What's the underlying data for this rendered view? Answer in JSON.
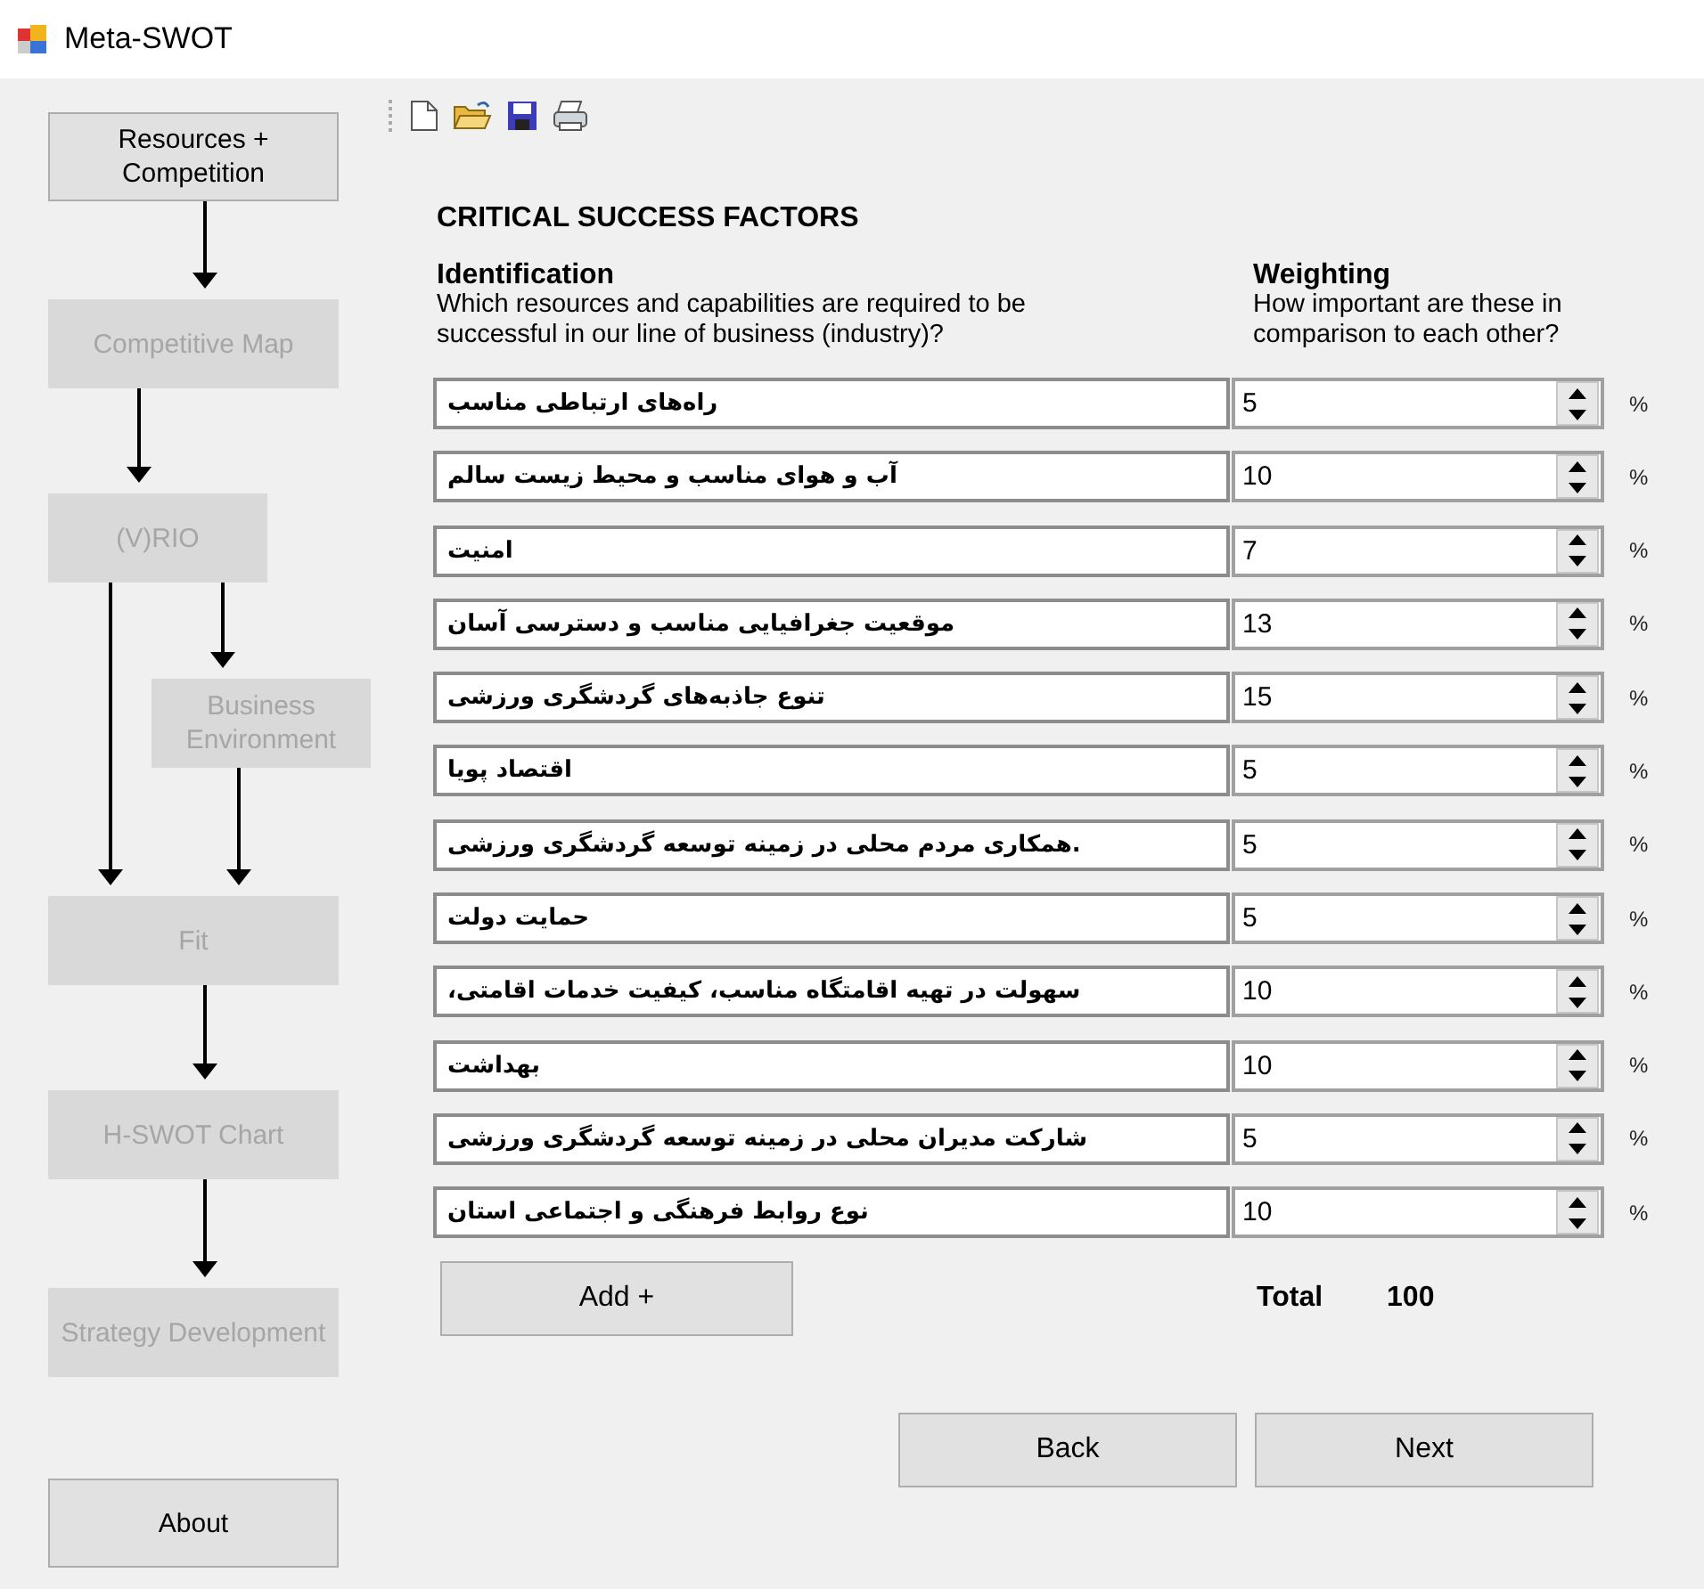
{
  "window": {
    "title": "Meta-SWOT"
  },
  "flow_steps": [
    {
      "label": "Resources + Competition",
      "disabled": false
    },
    {
      "label": "Competitive Map",
      "disabled": true
    },
    {
      "label": "(V)RIO",
      "disabled": true
    },
    {
      "label": "Business Environment",
      "disabled": true
    },
    {
      "label": "Fit",
      "disabled": true
    },
    {
      "label": "H-SWOT Chart",
      "disabled": true
    },
    {
      "label": "Strategy Development",
      "disabled": true
    }
  ],
  "about_button": "About",
  "heading": "CRITICAL SUCCESS FACTORS",
  "identification": {
    "title": "Identification",
    "description": "Which resources and capabilities are required to be successful in our line of business (industry)?"
  },
  "weighting": {
    "title": "Weighting",
    "description": "How important are these in comparison to each other?"
  },
  "factors": [
    {
      "name": "راه‌های ارتباطی مناسب",
      "weight": "5",
      "unit": "%"
    },
    {
      "name": "آب و هوای مناسب و محیط زیست سالم",
      "weight": "10",
      "unit": "%"
    },
    {
      "name": "امنیت",
      "weight": "7",
      "unit": "%"
    },
    {
      "name": "موقعیت جغرافیایی مناسب و دسترسی آسان",
      "weight": "13",
      "unit": "%"
    },
    {
      "name": "تنوع جاذبه‌های گردشگری ورزشی",
      "weight": "15",
      "unit": "%"
    },
    {
      "name": "اقتصاد پویا",
      "weight": "5",
      "unit": "%"
    },
    {
      "name": ".همکاری مردم محلی در زمینه توسعه گردشگری ورزشی",
      "weight": "5",
      "unit": "%"
    },
    {
      "name": "حمایت دولت",
      "weight": "5",
      "unit": "%"
    },
    {
      "name": "سهولت در تهیه اقامتگاه مناسب، کیفیت خدمات اقامتی،",
      "weight": "10",
      "unit": "%"
    },
    {
      "name": "بهداشت",
      "weight": "10",
      "unit": "%"
    },
    {
      "name": "شارکت مدیران محلی در زمینه توسعه گردشگری ورزشی",
      "weight": "5",
      "unit": "%"
    },
    {
      "name": "نوع روابط فرهنگی و اجتماعی استان",
      "weight": "10",
      "unit": "%"
    }
  ],
  "add_button": "Add +",
  "total": {
    "label": "Total",
    "value": "100"
  },
  "back_button": "Back",
  "next_button": "Next"
}
